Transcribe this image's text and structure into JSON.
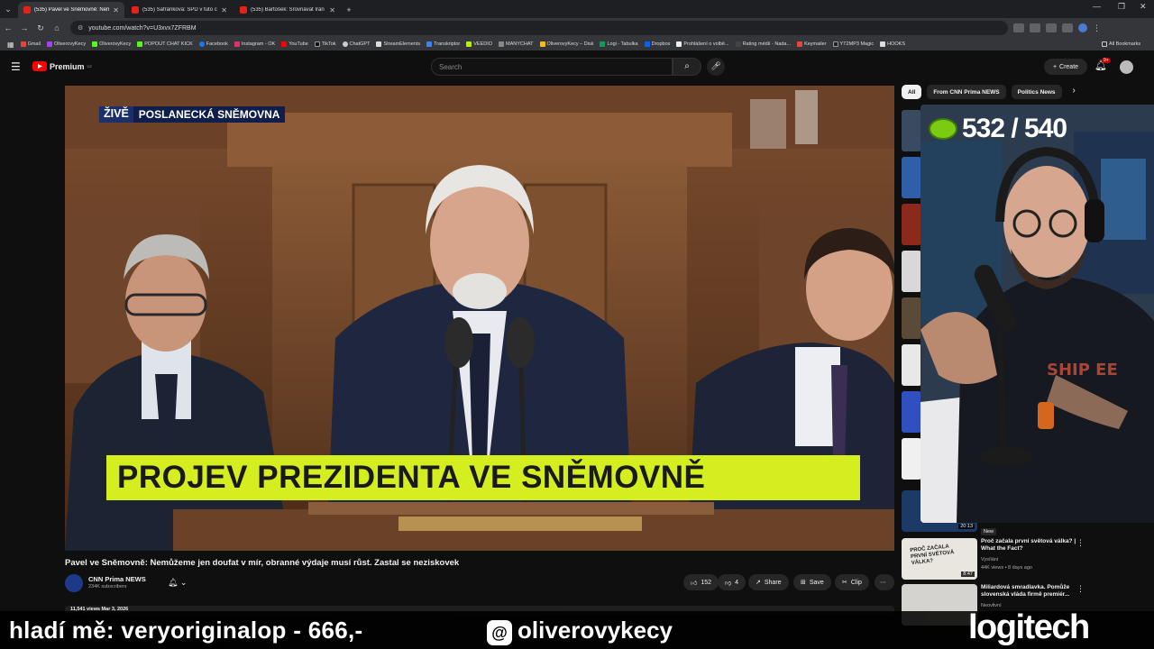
{
  "browser": {
    "tabs": [
      {
        "title": "(535) Pavel ve Sněmovně: Nem",
        "active": true
      },
      {
        "title": "(535) Šafránková: SPD v tuto ch",
        "active": false
      },
      {
        "title": "(535) Bartošek: Srovnávat Írán s",
        "active": false
      }
    ],
    "new_tab": "+",
    "url": "youtube.com/watch?v=U3xvx7ZFRBM",
    "bookmarks": [
      "Gmail",
      "OliverovyKecy",
      "OliverovyKecy",
      "POPOUT CHAT KICK",
      "Facebook",
      "Instagram - OK",
      "YouTube",
      "TikTok",
      "ChatGPT",
      "StreamElements",
      "Transkriptor",
      "VEEDIO",
      "MANYCHAT",
      "OliverovyKecy – Disk",
      "Logi - Tabulka",
      "Dropbox",
      "Prohlášení o volbě...",
      "Rating médií - Nada...",
      "Keymailer",
      "YT2MP3 Magic",
      "HOOKS"
    ],
    "all_bookmarks": "All Bookmarks"
  },
  "youtube": {
    "logo_text": "Premium",
    "logo_sup": "CZ",
    "search_placeholder": "Search",
    "create_label": "Create",
    "notif_badge": "9+"
  },
  "video": {
    "live_tag": "ŽIVĚ",
    "channel_tag": "POSLANECKÁ SNĚMOVNA",
    "lower_third": "PROJEV PREZIDENTA VE SNĚMOVNĚ",
    "title": "Pavel ve Sněmovně: Nemůžeme jen doufat v mír, obranné výdaje musí růst. Zastal se neziskovek",
    "channel": "CNN Prima NEWS",
    "subscribers": "234K subscribers",
    "likes": "152",
    "dislikes": "4",
    "share": "Share",
    "save": "Save",
    "clip": "Clip",
    "views_date": "11,541 views  Mar 3, 2026"
  },
  "sidebar": {
    "chips": [
      "All",
      "From CNN Prima NEWS",
      "Politics News"
    ],
    "recs": [
      {
        "title": "Proč začala první světová válka? | What the Fact?",
        "channel": "Vysílání",
        "meta": "44K views • 8 days ago",
        "duration": "8:47",
        "thumb_text": "PROČ ZAČALA PRVNÍ SVĚTOVÁ VÁLKA?"
      },
      {
        "title": "Miliardová smradlavka. Pomůže slovenská vláda firmě premiér...",
        "channel": "Neovlivní",
        "meta": "",
        "duration": ""
      }
    ],
    "partial_duration": "20:13",
    "partial_badge": "New"
  },
  "overlay": {
    "counter": "532 / 540",
    "promo_text": "hladí mě: veryoriginalop - 666,-",
    "handle": "oliverovykecy",
    "sponsor": "logitech"
  },
  "colors": {
    "lower_third_bg": "#d4ee1f",
    "live_red": "#c8102e",
    "yt_red": "#ff0000"
  }
}
